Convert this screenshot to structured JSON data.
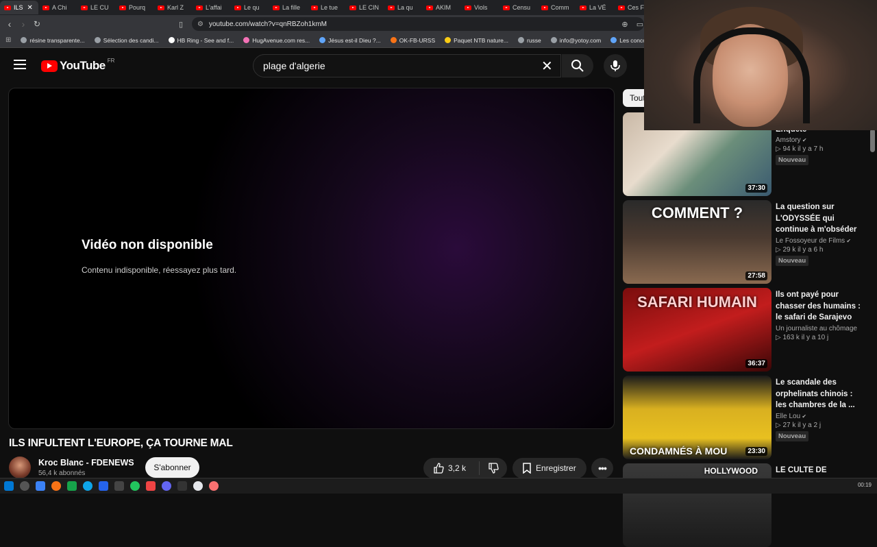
{
  "browser": {
    "tabs": [
      "ILS",
      "A Chi",
      "LE CU",
      "Pourq",
      "Karl Z",
      "L'affai",
      "Le qu",
      "La fille",
      "Le tue",
      "LE CIN",
      "La qu",
      "AKIM",
      "Viols",
      "Censu",
      "Comm",
      "La VÉ",
      "Ces F"
    ],
    "url": "youtube.com/watch?v=qnRBZoh1kmM",
    "bookmarks": [
      "résine transparente...",
      "Sélection des candi...",
      "HB Ring - See and f...",
      "HugAvenue.com res...",
      "Jésus est-il Dieu ?...",
      "OK-FB-URSS",
      "Paquet NTB nature...",
      "russe",
      "info@yotoy.com",
      "Les concours d'aute..."
    ]
  },
  "header": {
    "logo_text": "YouTube",
    "country_code": "FR",
    "search_value": "plage d'algerie"
  },
  "player": {
    "error_title": "Vidéo non disponible",
    "error_message": "Contenu indisponible, réessayez plus tard."
  },
  "video": {
    "title": "ILS INFULTENT L'EUROPE, ÇA TOURNE MAL",
    "channel_name": "Kroc Blanc - FDENEWS",
    "subscribers": "56,4 k abonnés",
    "subscribe_label": "S'abonner",
    "likes": "3,2 k",
    "save_label": "Enregistrer",
    "more_label": "•••"
  },
  "sidebar": {
    "chip_label": "Tout",
    "recommendations": [
      {
        "title": "Z se ressemble ? Enquête",
        "channel": "Amstory",
        "verified": true,
        "views": "94 k",
        "age": "il y a 7 h",
        "badge": "Nouveau",
        "duration": "37:30",
        "thumb_text": ""
      },
      {
        "title": "La question sur L'ODYSSÉE qui continue à m'obséder",
        "channel": "Le Fossoyeur de Films",
        "verified": true,
        "views": "29 k",
        "age": "il y a 6 h",
        "badge": "Nouveau",
        "duration": "27:58",
        "thumb_text": "COMMENT ?"
      },
      {
        "title": "Ils ont payé pour chasser des humains : le safari de Sarajevo",
        "channel": "Un journaliste au chômage",
        "verified": false,
        "views": "163 k",
        "age": "il y a 10 j",
        "badge": "",
        "duration": "36:37",
        "thumb_text": "SAFARI HUMAIN"
      },
      {
        "title": "Le scandale des orphelinats chinois : les chambres de la ...",
        "channel": "Elle Lou",
        "verified": true,
        "views": "27 k",
        "age": "il y a 2 j",
        "badge": "Nouveau",
        "duration": "23:30",
        "thumb_text": "CONDAMNÉS À MOU"
      },
      {
        "title": "LE CULTE DE L'ULTRA-",
        "channel": "",
        "verified": false,
        "views": "",
        "age": "",
        "badge": "",
        "duration": "",
        "thumb_text": "HOLLYWOOD"
      }
    ]
  },
  "taskbar": {
    "clock": "00:19"
  },
  "colors": {
    "brand_red": "#ff0000",
    "background": "#0f0f0f",
    "chip_bg": "#f1f1f1"
  }
}
